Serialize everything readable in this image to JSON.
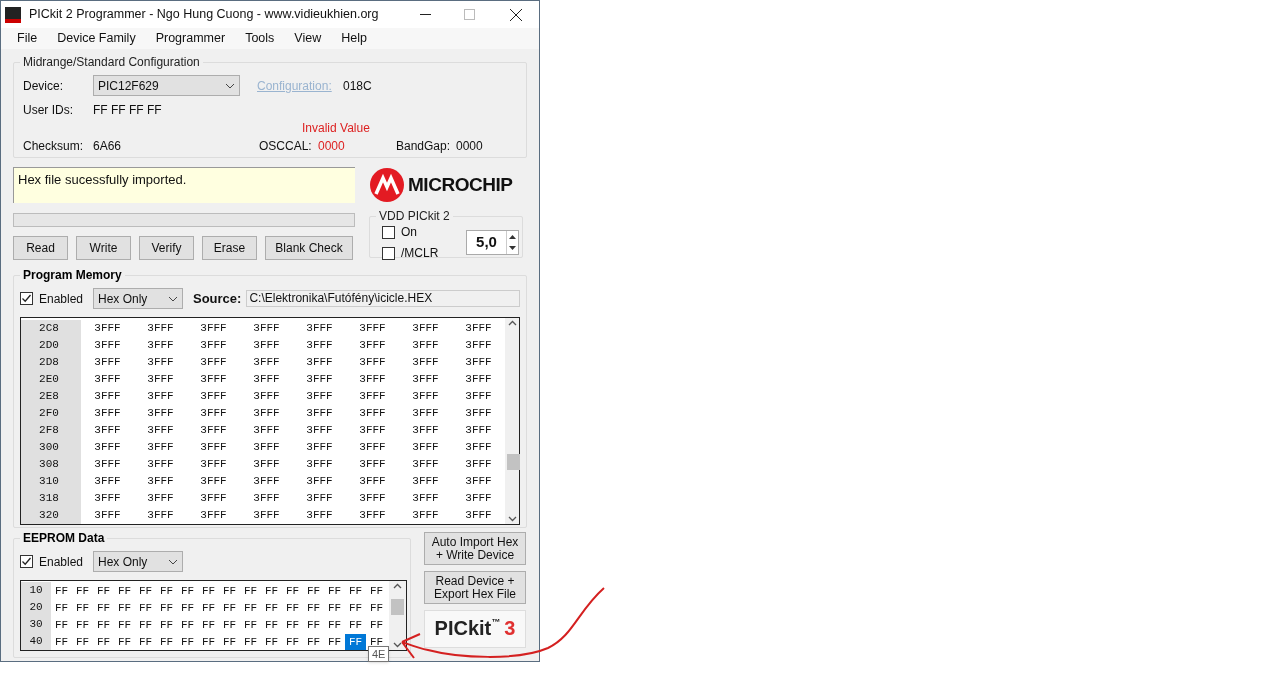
{
  "window": {
    "title": "PICkit 2 Programmer - Ngo Hung Cuong - www.vidieukhien.org"
  },
  "menu": [
    "File",
    "Device Family",
    "Programmer",
    "Tools",
    "View",
    "Help"
  ],
  "configuration": {
    "title": "Midrange/Standard Configuration",
    "device_label": "Device:",
    "device": "PIC12F629",
    "configuration_link": "Configuration:",
    "configuration_value": "018C",
    "user_ids_label": "User IDs:",
    "user_ids": "FF FF FF FF",
    "checksum_label": "Checksum:",
    "checksum": "6A66",
    "osccal_warning": "Invalid Value",
    "osccal_label": "OSCCAL:",
    "osccal": "0000",
    "bandgap_label": "BandGap:",
    "bandgap": "0000"
  },
  "status": {
    "message": "Hex file sucessfully imported."
  },
  "progress": {
    "level": 0
  },
  "logo": {
    "text": "MICROCHIP"
  },
  "buttons": [
    "Read",
    "Write",
    "Verify",
    "Erase",
    "Blank Check"
  ],
  "vdd": {
    "title": "VDD PICkit 2",
    "options": [
      {
        "label": "On",
        "checked": false
      },
      {
        "label": "/MCLR",
        "checked": false
      }
    ],
    "value": "5,0"
  },
  "program_memory": {
    "title": "Program Memory",
    "enabled_label": "Enabled",
    "enabled": true,
    "mode": "Hex Only",
    "source_label": "Source:",
    "source": "C:\\Elektronika\\Futófény\\icicle.HEX",
    "rows": [
      {
        "address": "2C8",
        "cells": [
          "3FFF",
          "3FFF",
          "3FFF",
          "3FFF",
          "3FFF",
          "3FFF",
          "3FFF",
          "3FFF"
        ]
      },
      {
        "address": "2D0",
        "cells": [
          "3FFF",
          "3FFF",
          "3FFF",
          "3FFF",
          "3FFF",
          "3FFF",
          "3FFF",
          "3FFF"
        ]
      },
      {
        "address": "2D8",
        "cells": [
          "3FFF",
          "3FFF",
          "3FFF",
          "3FFF",
          "3FFF",
          "3FFF",
          "3FFF",
          "3FFF"
        ]
      },
      {
        "address": "2E0",
        "cells": [
          "3FFF",
          "3FFF",
          "3FFF",
          "3FFF",
          "3FFF",
          "3FFF",
          "3FFF",
          "3FFF"
        ]
      },
      {
        "address": "2E8",
        "cells": [
          "3FFF",
          "3FFF",
          "3FFF",
          "3FFF",
          "3FFF",
          "3FFF",
          "3FFF",
          "3FFF"
        ]
      },
      {
        "address": "2F0",
        "cells": [
          "3FFF",
          "3FFF",
          "3FFF",
          "3FFF",
          "3FFF",
          "3FFF",
          "3FFF",
          "3FFF"
        ]
      },
      {
        "address": "2F8",
        "cells": [
          "3FFF",
          "3FFF",
          "3FFF",
          "3FFF",
          "3FFF",
          "3FFF",
          "3FFF",
          "3FFF"
        ]
      },
      {
        "address": "300",
        "cells": [
          "3FFF",
          "3FFF",
          "3FFF",
          "3FFF",
          "3FFF",
          "3FFF",
          "3FFF",
          "3FFF"
        ]
      },
      {
        "address": "308",
        "cells": [
          "3FFF",
          "3FFF",
          "3FFF",
          "3FFF",
          "3FFF",
          "3FFF",
          "3FFF",
          "3FFF"
        ]
      },
      {
        "address": "310",
        "cells": [
          "3FFF",
          "3FFF",
          "3FFF",
          "3FFF",
          "3FFF",
          "3FFF",
          "3FFF",
          "3FFF"
        ]
      },
      {
        "address": "318",
        "cells": [
          "3FFF",
          "3FFF",
          "3FFF",
          "3FFF",
          "3FFF",
          "3FFF",
          "3FFF",
          "3FFF"
        ]
      },
      {
        "address": "320",
        "cells": [
          "3FFF",
          "3FFF",
          "3FFF",
          "3FFF",
          "3FFF",
          "3FFF",
          "3FFF",
          "3FFF"
        ]
      }
    ]
  },
  "eeprom": {
    "title": "EEPROM Data",
    "enabled_label": "Enabled",
    "enabled": true,
    "mode": "Hex Only",
    "tooltip": "4E",
    "rows": [
      {
        "address": "10",
        "cells": [
          {
            "value": "FF",
            "selected": false
          },
          {
            "value": "FF",
            "selected": false
          },
          {
            "value": "FF",
            "selected": false
          },
          {
            "value": "FF",
            "selected": false
          },
          {
            "value": "FF",
            "selected": false
          },
          {
            "value": "FF",
            "selected": false
          },
          {
            "value": "FF",
            "selected": false
          },
          {
            "value": "FF",
            "selected": false
          },
          {
            "value": "FF",
            "selected": false
          },
          {
            "value": "FF",
            "selected": false
          },
          {
            "value": "FF",
            "selected": false
          },
          {
            "value": "FF",
            "selected": false
          },
          {
            "value": "FF",
            "selected": false
          },
          {
            "value": "FF",
            "selected": false
          },
          {
            "value": "FF",
            "selected": false
          },
          {
            "value": "FF",
            "selected": false
          }
        ]
      },
      {
        "address": "20",
        "cells": [
          {
            "value": "FF",
            "selected": false
          },
          {
            "value": "FF",
            "selected": false
          },
          {
            "value": "FF",
            "selected": false
          },
          {
            "value": "FF",
            "selected": false
          },
          {
            "value": "FF",
            "selected": false
          },
          {
            "value": "FF",
            "selected": false
          },
          {
            "value": "FF",
            "selected": false
          },
          {
            "value": "FF",
            "selected": false
          },
          {
            "value": "FF",
            "selected": false
          },
          {
            "value": "FF",
            "selected": false
          },
          {
            "value": "FF",
            "selected": false
          },
          {
            "value": "FF",
            "selected": false
          },
          {
            "value": "FF",
            "selected": false
          },
          {
            "value": "FF",
            "selected": false
          },
          {
            "value": "FF",
            "selected": false
          },
          {
            "value": "FF",
            "selected": false
          }
        ]
      },
      {
        "address": "30",
        "cells": [
          {
            "value": "FF",
            "selected": false
          },
          {
            "value": "FF",
            "selected": false
          },
          {
            "value": "FF",
            "selected": false
          },
          {
            "value": "FF",
            "selected": false
          },
          {
            "value": "FF",
            "selected": false
          },
          {
            "value": "FF",
            "selected": false
          },
          {
            "value": "FF",
            "selected": false
          },
          {
            "value": "FF",
            "selected": false
          },
          {
            "value": "FF",
            "selected": false
          },
          {
            "value": "FF",
            "selected": false
          },
          {
            "value": "FF",
            "selected": false
          },
          {
            "value": "FF",
            "selected": false
          },
          {
            "value": "FF",
            "selected": false
          },
          {
            "value": "FF",
            "selected": false
          },
          {
            "value": "FF",
            "selected": false
          },
          {
            "value": "FF",
            "selected": false
          }
        ]
      },
      {
        "address": "40",
        "cells": [
          {
            "value": "FF",
            "selected": false
          },
          {
            "value": "FF",
            "selected": false
          },
          {
            "value": "FF",
            "selected": false
          },
          {
            "value": "FF",
            "selected": false
          },
          {
            "value": "FF",
            "selected": false
          },
          {
            "value": "FF",
            "selected": false
          },
          {
            "value": "FF",
            "selected": false
          },
          {
            "value": "FF",
            "selected": false
          },
          {
            "value": "FF",
            "selected": false
          },
          {
            "value": "FF",
            "selected": false
          },
          {
            "value": "FF",
            "selected": false
          },
          {
            "value": "FF",
            "selected": false
          },
          {
            "value": "FF",
            "selected": false
          },
          {
            "value": "FF",
            "selected": false
          },
          {
            "value": "FF",
            "selected": true
          },
          {
            "value": "FF",
            "selected": false
          }
        ]
      }
    ]
  },
  "side_buttons": [
    {
      "lines": [
        "Auto Import Hex",
        "+ Write Device"
      ]
    },
    {
      "lines": [
        "Read Device +",
        "Export Hex File"
      ]
    }
  ],
  "pickit_logo": {
    "name": "PICkit",
    "mark": "™",
    "number": "3"
  }
}
